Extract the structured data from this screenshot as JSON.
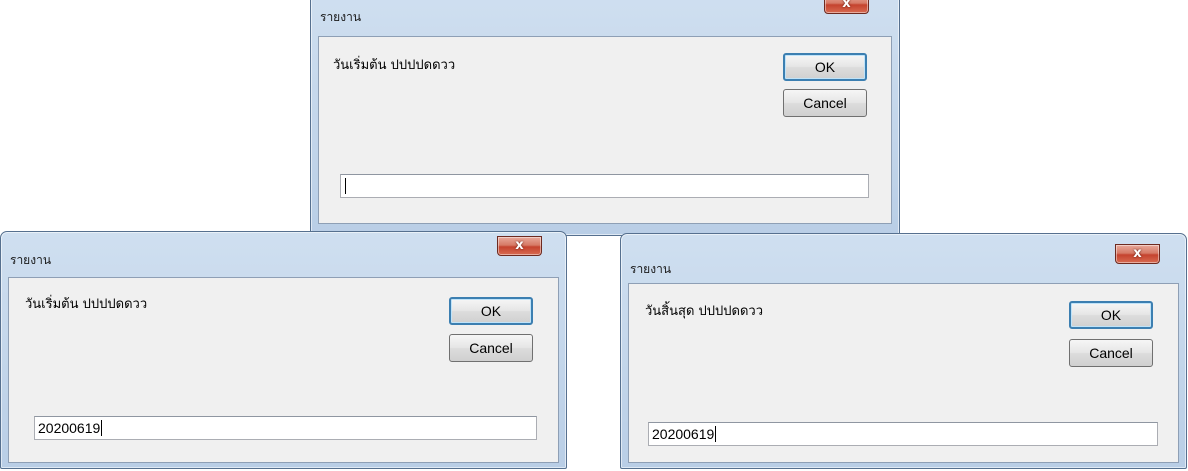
{
  "dialogs": [
    {
      "title": "รายงาน",
      "close_glyph": "x",
      "prompt": "วันเริ่มต้น ปปปปดดวว",
      "ok_label": "OK",
      "cancel_label": "Cancel",
      "input_value": ""
    },
    {
      "title": "รายงาน",
      "close_glyph": "x",
      "prompt": "วันเริ่มต้น ปปปปดดวว",
      "ok_label": "OK",
      "cancel_label": "Cancel",
      "input_value": "20200619"
    },
    {
      "title": "รายงาน",
      "close_glyph": "x",
      "prompt": "วันสิ้นสุด ปปปปดดวว",
      "ok_label": "OK",
      "cancel_label": "Cancel",
      "input_value": "20200619"
    }
  ],
  "colors": {
    "titlebar": "#c4d7ec",
    "close_button": "#c9492f",
    "client_area": "#f0f0f0",
    "default_button_border": "#3c7fb1"
  },
  "icons": {
    "close": "close-icon"
  }
}
